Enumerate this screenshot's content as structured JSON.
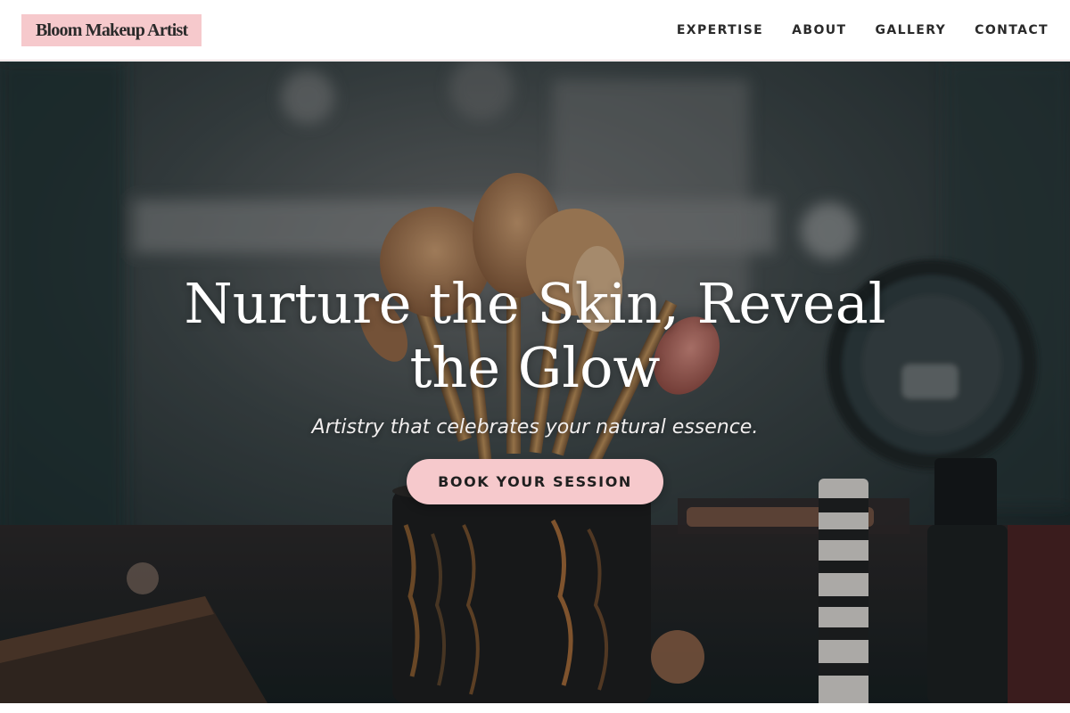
{
  "header": {
    "logo_text": "Bloom Makeup Artist",
    "nav": [
      {
        "label": "EXPERTISE"
      },
      {
        "label": "ABOUT"
      },
      {
        "label": "GALLERY"
      },
      {
        "label": "CONTACT"
      }
    ]
  },
  "hero": {
    "title": "Nurture the Skin, Reveal the Glow",
    "subtitle": "Artistry that celebrates your natural essence.",
    "cta_label": "BOOK YOUR SESSION"
  },
  "colors": {
    "accent_pink": "#f6c9cc",
    "text_dark": "#2a2a2a",
    "hero_dark": "#1d2b2e"
  }
}
